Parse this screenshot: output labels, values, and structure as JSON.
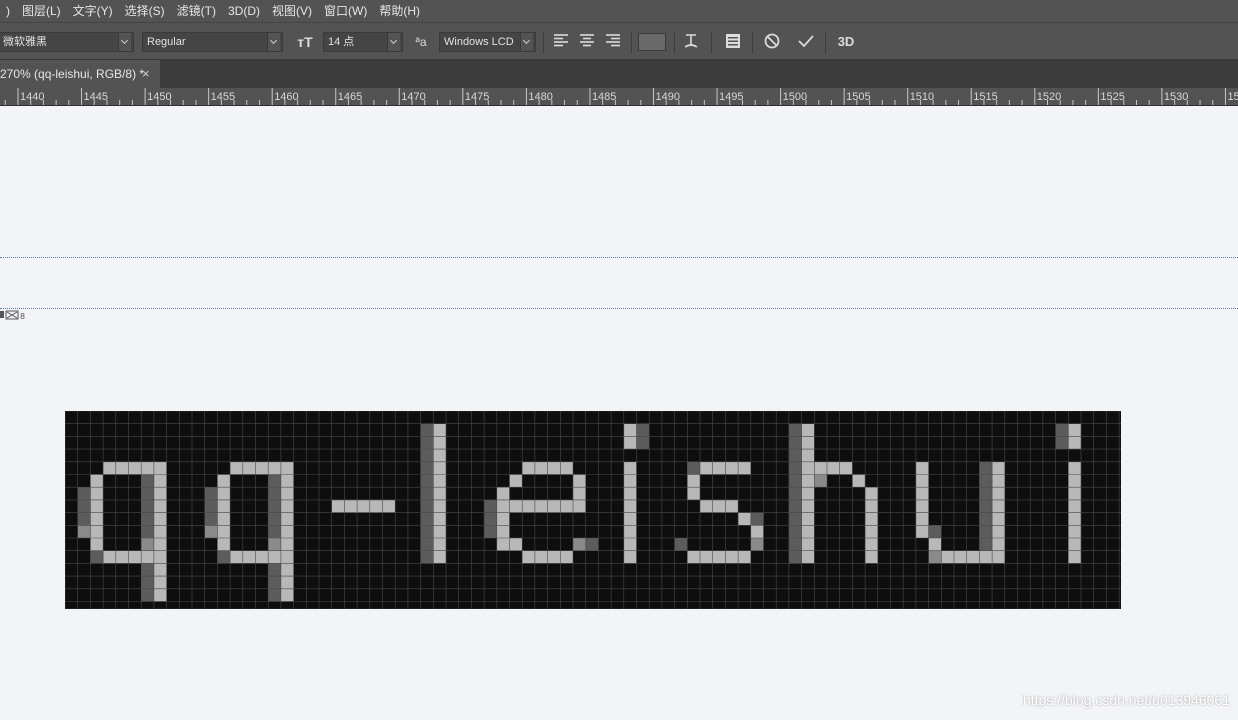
{
  "menubar": {
    "items": [
      ")",
      "图层(L)",
      "文字(Y)",
      "选择(S)",
      "滤镜(T)",
      "3D(D)",
      "视图(V)",
      "窗口(W)",
      "帮助(H)"
    ]
  },
  "options": {
    "font_family": "微软雅黑",
    "font_style": "Regular",
    "font_size": "14 点",
    "antialias": "Windows LCD",
    "three_d_label": "3D",
    "size_icon_label": "тT",
    "antialias_icon_label": "ªa"
  },
  "document": {
    "tab_title": "270% (qq-leishui, RGB/8) *",
    "close_symbol": "×"
  },
  "ruler": {
    "labels": [
      "1440",
      "1445",
      "1450",
      "1455",
      "1460",
      "1465",
      "1470",
      "1475",
      "1480",
      "1485",
      "1490",
      "1495",
      "1500",
      "1505",
      "1510",
      "1515",
      "1520",
      "1525",
      "1530",
      "15"
    ]
  },
  "canvas": {
    "text_layer_content": "qq-leishui",
    "background_color": "#f3f4f7",
    "grid_bg": "#0e0e0e",
    "grid_line": "#4a4a4a",
    "shade_colors": [
      "#0e0e0e",
      "#3a3a3a",
      "#5c5c5c",
      "#8a8a8a",
      "#b8b8b8"
    ]
  },
  "watermark": "https://blog.csdn.net/u013946061"
}
